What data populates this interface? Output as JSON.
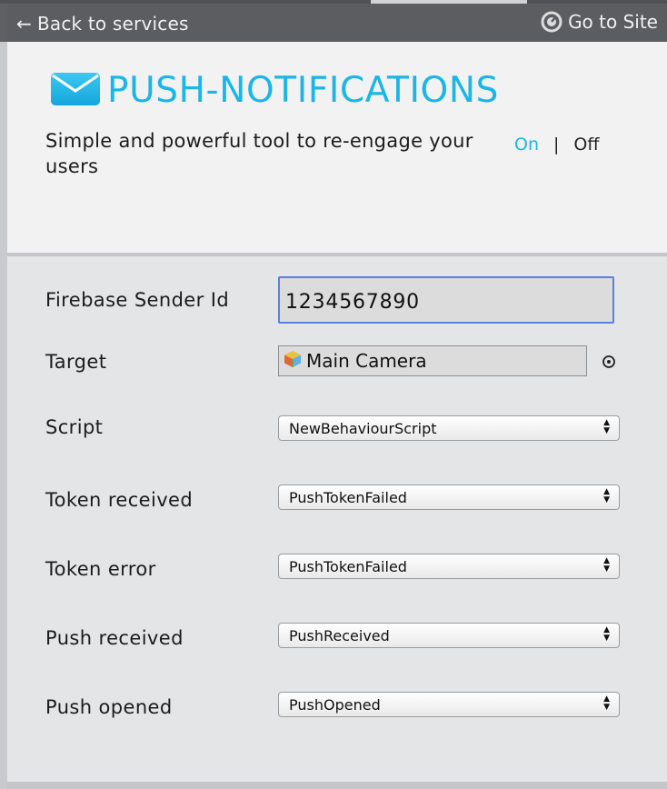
{
  "header": {
    "back_label": "Back to services",
    "site_label": "Go to Site"
  },
  "service": {
    "title": "PUSH-NOTIFICATIONS",
    "description": "Simple and powerful tool to re-engage your users",
    "toggle": {
      "on": "On",
      "separator": "|",
      "off": "Off",
      "active": "On"
    }
  },
  "form": {
    "sender_id": {
      "label": "Firebase Sender Id",
      "value": "1234567890"
    },
    "target": {
      "label": "Target",
      "value": "Main Camera"
    },
    "script": {
      "label": "Script",
      "value": "NewBehaviourScript"
    },
    "token_received": {
      "label": "Token received",
      "value": "PushTokenFailed"
    },
    "token_error": {
      "label": "Token error",
      "value": "PushTokenFailed"
    },
    "push_received": {
      "label": "Push received",
      "value": "PushReceived"
    },
    "push_opened": {
      "label": "Push opened",
      "value": "PushOpened"
    }
  },
  "colors": {
    "accent": "#1ab6e8",
    "header_bg": "#5b5d61",
    "focus_border": "#5b7fe0"
  },
  "icons": {
    "back": "left-arrow-icon",
    "site": "speedometer-icon",
    "service": "envelope-icon",
    "target": "gameobject-cube-icon",
    "picker": "object-picker-icon",
    "dropdown": "updown-arrows-icon"
  }
}
